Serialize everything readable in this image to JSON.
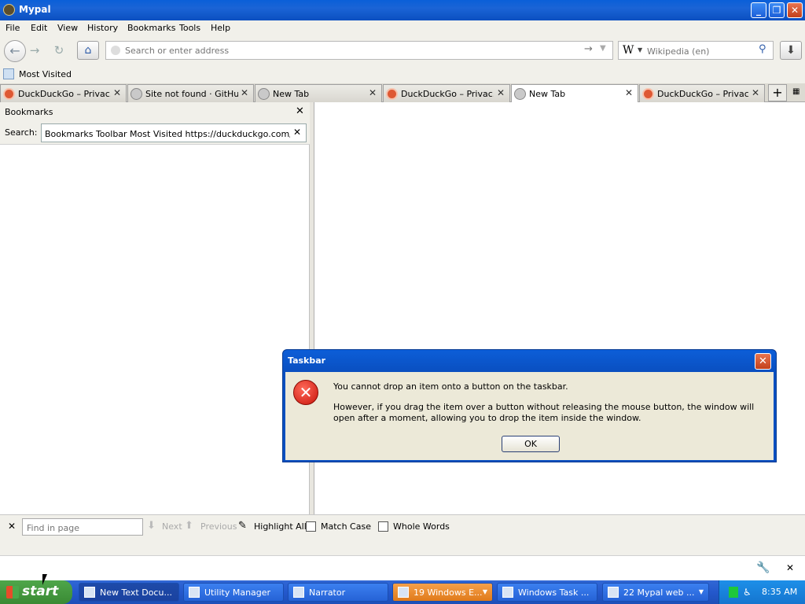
{
  "window": {
    "title": "Mypal"
  },
  "menu": [
    "File",
    "Edit",
    "View",
    "History",
    "Bookmarks",
    "Tools",
    "Help"
  ],
  "navbar": {
    "url_placeholder": "Search or enter address",
    "search_placeholder": "Wikipedia (en)",
    "search_engine_logo": "W"
  },
  "bookmarks_toolbar": {
    "most_visited": "Most Visited"
  },
  "tabs": [
    {
      "label": "DuckDuckGo – Privac...",
      "icon": "ddg",
      "active": false
    },
    {
      "label": "Site not found · GitHub ...",
      "icon": "globe",
      "active": false
    },
    {
      "label": "New Tab",
      "icon": "globe",
      "active": false
    },
    {
      "label": "DuckDuckGo – Privac...",
      "icon": "ddg",
      "active": false
    },
    {
      "label": "New Tab",
      "icon": "globe",
      "active": true
    },
    {
      "label": "DuckDuckGo – Privac...",
      "icon": "ddg",
      "active": false
    }
  ],
  "sidebar": {
    "title": "Bookmarks",
    "search_label": "Search:",
    "search_value": "Bookmarks Toolbar Most Visited https://duckduckgo.com/?t=pale"
  },
  "findbar": {
    "placeholder": "Find in page",
    "next": "Next",
    "previous": "Previous",
    "highlight_all": "Highlight All",
    "match_case": "Match Case",
    "whole_words": "Whole Words"
  },
  "dialog": {
    "title": "Taskbar",
    "message": "You cannot drop an item onto a button on the taskbar.",
    "detail": "However, if you drag the item over a button without releasing the mouse button, the window will open after a moment, allowing you to drop the item inside the window.",
    "ok": "OK"
  },
  "taskbar": {
    "start": "start",
    "items": [
      {
        "label": "New Text Docu...",
        "state": "active"
      },
      {
        "label": "Utility Manager",
        "state": "normal"
      },
      {
        "label": "Narrator",
        "state": "normal"
      },
      {
        "label": "19 Windows E...",
        "state": "flash",
        "group": true
      },
      {
        "label": "Windows Task ...",
        "state": "normal"
      },
      {
        "label": "22 Mypal web ...",
        "state": "normal",
        "group": true
      }
    ],
    "clock": "8:35 AM"
  },
  "colors": {
    "titlebar": "#0a5fd8",
    "taskbar": "#2458cc",
    "start_button": "#3a8a34",
    "error": "#c8140a"
  }
}
